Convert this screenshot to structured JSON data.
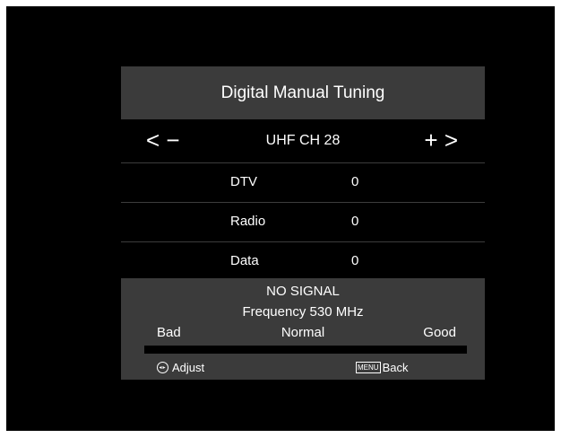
{
  "screen": {
    "title": "Digital Manual Tuning",
    "channel": {
      "label": "UHF CH 28",
      "left_glyph": "< −",
      "right_glyph": "+ >"
    },
    "counts": [
      {
        "label": "DTV",
        "value": "0"
      },
      {
        "label": "Radio",
        "value": "0"
      },
      {
        "label": "Data",
        "value": "0"
      }
    ],
    "signal": {
      "status": "NO SIGNAL",
      "frequency": "Frequency 530 MHz",
      "quality_bad": "Bad",
      "quality_normal": "Normal",
      "quality_good": "Good",
      "level_fraction": 0
    },
    "hints": {
      "adjust_label": "Adjust",
      "menu_key": "MENU",
      "back_label": "Back"
    }
  },
  "colors": {
    "background": "#000000",
    "panel_header": "#3b3b3b",
    "text": "#ffffff"
  }
}
